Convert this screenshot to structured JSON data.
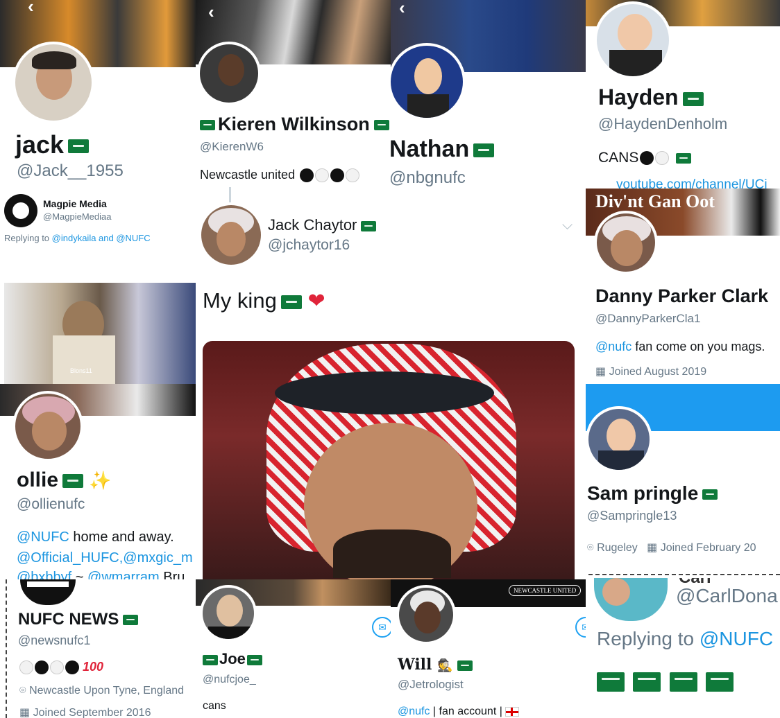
{
  "colors": {
    "link": "#1b95e0",
    "muted": "#657786",
    "flag": "#0f7a3a"
  },
  "icons": [
    "back-chevron-icon",
    "calendar-icon",
    "location-icon",
    "expand-chevron-icon",
    "mail-icon",
    "heart-icon",
    "sparkles-icon",
    "saudi-flag-icon",
    "england-flag-icon",
    "detective-icon",
    "hundred-icon"
  ],
  "jack": {
    "name": "jack",
    "handle": "@Jack__1955"
  },
  "magpie": {
    "name": "Magpie Media",
    "handle": "@MagpieMediaa",
    "replying_prefix": "Replying to ",
    "replying_links": "@indykaila and @NUFC"
  },
  "kieren": {
    "name": "Kieren Wilkinson",
    "handle": "@KierenW6",
    "bio": "Newcastle united"
  },
  "chaytor": {
    "name": "Jack Chaytor",
    "handle": "@jchaytor16",
    "tweet": "My king"
  },
  "nathan": {
    "name": "Nathan",
    "handle": "@nbgnufc"
  },
  "hayden": {
    "name": "Hayden",
    "handle": "@HaydenDenholm",
    "bio": "CANS",
    "link_fragment": "youtube.com/channel/UCi"
  },
  "danny": {
    "banner_text": "Div'nt Gan Oot",
    "name": "Danny Parker Clark",
    "handle": "@DannyParkerCla1",
    "bio_link": "@nufc",
    "bio": " fan come on you mags.",
    "joined": "Joined August 2019"
  },
  "video": {
    "watermark": "Blons11"
  },
  "ollie": {
    "name": "ollie",
    "handle": "@ollienufc",
    "bio_line1_link": "@NUFC",
    "bio_line1": " home and away.",
    "bio_line2": "@Official_HUFC,@mxgic_m",
    "bio_line3_link1": "@bxbbyf",
    "bio_line3_sep": " ~ ",
    "bio_line3_link2": "@wmarram",
    "bio_line3_tail": " Bru"
  },
  "sam": {
    "name": "Sam pringle",
    "handle": "@Sampringle13",
    "location": "Rugeley",
    "joined": "Joined February 20"
  },
  "nufcnews": {
    "name": "NUFC NEWS",
    "handle": "@newsnufc1",
    "location": "Newcastle Upon Tyne, England",
    "joined": "Joined September 2016"
  },
  "joe": {
    "name": "Joe",
    "handle": "@nufcjoe_",
    "bio": "cans"
  },
  "will": {
    "name": "Will",
    "handle": "@Jetrologist",
    "bio_link": "@nufc",
    "bio": " | fan account | ",
    "banner_text": "NEWCASTLE UNITED"
  },
  "carl": {
    "name_fragment": "Carl",
    "handle": "@CarlDona",
    "replying_prefix": "Replying to ",
    "replying_link": "@NUFC"
  }
}
